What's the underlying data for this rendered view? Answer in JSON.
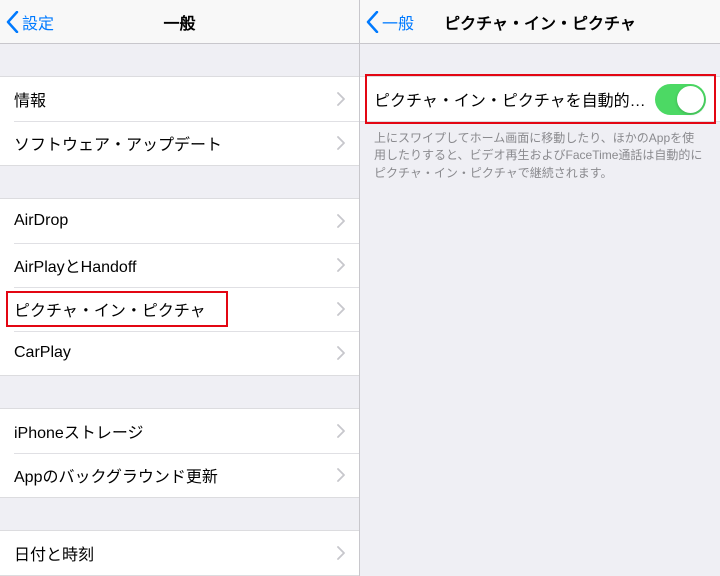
{
  "left": {
    "back": "設定",
    "title": "一般",
    "groups": [
      [
        "情報",
        "ソフトウェア・アップデート"
      ],
      [
        "AirDrop",
        "AirPlayとHandoff",
        "ピクチャ・イン・ピクチャ",
        "CarPlay"
      ],
      [
        "iPhoneストレージ",
        "Appのバックグラウンド更新"
      ],
      [
        "日付と時刻"
      ]
    ]
  },
  "right": {
    "back": "一般",
    "title": "ピクチャ・イン・ピクチャ",
    "toggle_label": "ピクチャ・イン・ピクチャを自動的…",
    "toggle_on": true,
    "footer": "上にスワイプしてホーム画面に移動したり、ほかのAppを使用したりすると、ビデオ再生およびFaceTime通話は自動的にピクチャ・イン・ピクチャで継続されます。"
  }
}
